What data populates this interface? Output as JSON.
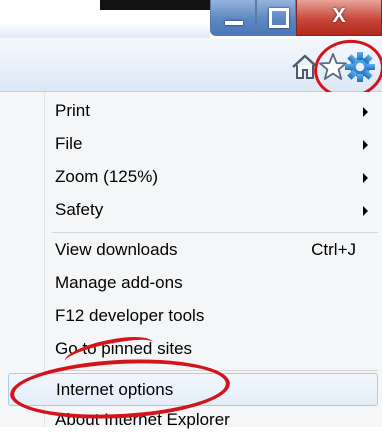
{
  "window": {
    "controls": {
      "minimize_icon": "minimize-icon",
      "maximize_icon": "maximize-icon",
      "close_label": "X"
    }
  },
  "command_bar": {
    "icons": [
      "home-icon",
      "favorites-star-icon",
      "tools-gear-icon"
    ]
  },
  "menu": {
    "groups": [
      [
        {
          "label": "Print",
          "submenu": true
        },
        {
          "label": "File",
          "submenu": true
        },
        {
          "label": "Zoom (125%)",
          "submenu": true
        },
        {
          "label": "Safety",
          "submenu": true
        }
      ],
      [
        {
          "label": "View downloads",
          "shortcut": "Ctrl+J"
        },
        {
          "label": "Manage add-ons"
        },
        {
          "label": "F12 developer tools"
        },
        {
          "label": "Go to pinned sites"
        }
      ],
      [
        {
          "label": "Internet options",
          "highlighted": true
        },
        {
          "label": "About Internet Explorer"
        }
      ]
    ]
  },
  "colors": {
    "annotation_red": "#d4141a",
    "hover_border": "#aecbef",
    "close_button_red": "#c8473a",
    "window_button_blue": "#5d87c3"
  }
}
